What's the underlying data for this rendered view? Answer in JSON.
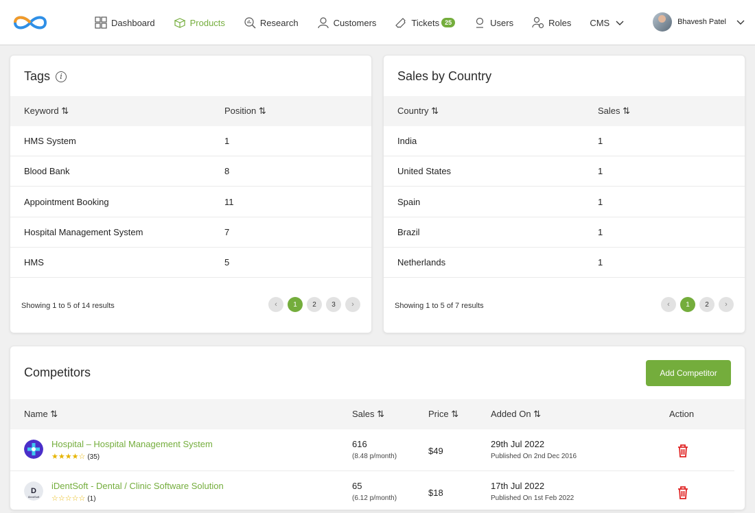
{
  "nav": {
    "items": [
      {
        "label": "Dashboard",
        "icon": "dashboard-icon"
      },
      {
        "label": "Products",
        "icon": "box-icon",
        "active": true
      },
      {
        "label": "Research",
        "icon": "research-icon"
      },
      {
        "label": "Customers",
        "icon": "customers-icon"
      },
      {
        "label": "Tickets",
        "icon": "ticket-icon",
        "badge": "25"
      },
      {
        "label": "Users",
        "icon": "users-icon"
      },
      {
        "label": "Roles",
        "icon": "roles-icon"
      },
      {
        "label": "CMS",
        "icon": "chevron-down-icon"
      }
    ],
    "user_name": "Bhavesh Patel",
    "accent": "#74ad3c"
  },
  "tags": {
    "title": "Tags",
    "col_keyword": "Keyword ⇅",
    "col_position": "Position ⇅",
    "rows": [
      {
        "keyword": "HMS System",
        "position": "1"
      },
      {
        "keyword": "Blood Bank",
        "position": "8"
      },
      {
        "keyword": "Appointment Booking",
        "position": "11"
      },
      {
        "keyword": "Hospital Management System",
        "position": "7"
      },
      {
        "keyword": "HMS",
        "position": "5"
      }
    ],
    "showing": "Showing 1 to 5 of 14 results",
    "pages": [
      "1",
      "2",
      "3"
    ],
    "current_page": "1"
  },
  "sales": {
    "title": "Sales by Country",
    "col_country": "Country ⇅",
    "col_sales": "Sales ⇅",
    "rows": [
      {
        "country": "India",
        "sales": "1"
      },
      {
        "country": "United States",
        "sales": "1"
      },
      {
        "country": "Spain",
        "sales": "1"
      },
      {
        "country": "Brazil",
        "sales": "1"
      },
      {
        "country": "Netherlands",
        "sales": "1"
      }
    ],
    "showing": "Showing 1 to 5 of 7 results",
    "pages": [
      "1",
      "2"
    ],
    "current_page": "1"
  },
  "competitors": {
    "title": "Competitors",
    "add_label": "Add Competitor",
    "cols": {
      "name": "Name ⇅",
      "sales": "Sales ⇅",
      "price": "Price ⇅",
      "added": "Added On ⇅",
      "action": "Action"
    },
    "rows": [
      {
        "name": "Hospital – Hospital Management System",
        "stars": "★★★★☆",
        "rating_count": "(35)",
        "rating": 4,
        "sales": "616",
        "sales_sub": "(8.48 p/month)",
        "price": "$49",
        "added": "29th Jul 2022",
        "published": "Published On 2nd Dec 2016"
      },
      {
        "name": "iDentSoft - Dental / Clinic Software Solution",
        "stars": "☆☆☆☆☆",
        "rating_count": "(1)",
        "rating": 0,
        "sales": "65",
        "sales_sub": "(6.12 p/month)",
        "price": "$18",
        "added": "17th Jul 2022",
        "published": "Published On 1st Feb 2022"
      }
    ]
  }
}
